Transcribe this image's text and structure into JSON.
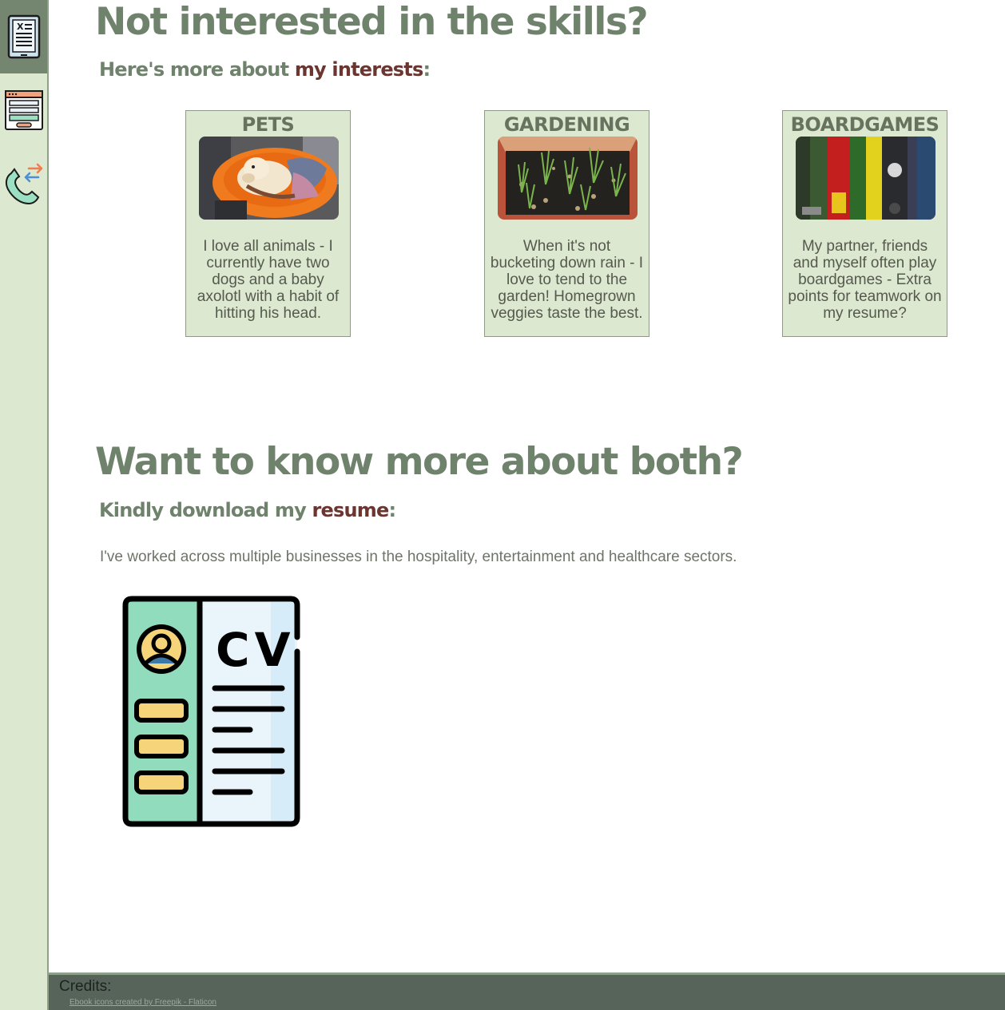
{
  "sidebar": {
    "items": [
      {
        "name": "ebook-icon"
      },
      {
        "name": "webpage-layout-icon"
      },
      {
        "name": "phone-contact-icon"
      }
    ]
  },
  "interests_section": {
    "heading": "Not interested in the skills?",
    "sub_prefix": "Here's more about ",
    "sub_accent": "my interests",
    "sub_suffix": ":",
    "cards": [
      {
        "title": "PETS",
        "photo": "dog in orange basket",
        "text": "I love all animals - I currently have two dogs and a baby axolotl with a habit of hitting his head."
      },
      {
        "title": "GARDENING",
        "photo": "garden bed with seedlings",
        "text": "When it's not bucketing down rain - I love to tend to the garden! Homegrown veggies taste the best."
      },
      {
        "title": "BOARDGAMES",
        "photo": "shelf of boardgame boxes",
        "text": "My partner, friends and myself often play boardgames - Extra points for teamwork on my resume?"
      }
    ]
  },
  "resume_section": {
    "heading": "Want to know more about both?",
    "sub_prefix": "Kindly download ",
    "sub_mid": "my ",
    "sub_accent": "resume",
    "sub_suffix": ":",
    "intro": "I've worked across multiple businesses in the hospitality, entertainment and healthcare sectors.",
    "cv_icon": {
      "name": "cv-document-icon",
      "letters": "CV"
    }
  },
  "footer": {
    "credits_title": "Credits:",
    "credit_link": "Ebook icons created by Freepik - Flaticon"
  },
  "colors": {
    "heading": "#6f826c",
    "accent": "#6b3530",
    "card_bg": "#dce8cf",
    "footer_bg": "#57645a"
  }
}
